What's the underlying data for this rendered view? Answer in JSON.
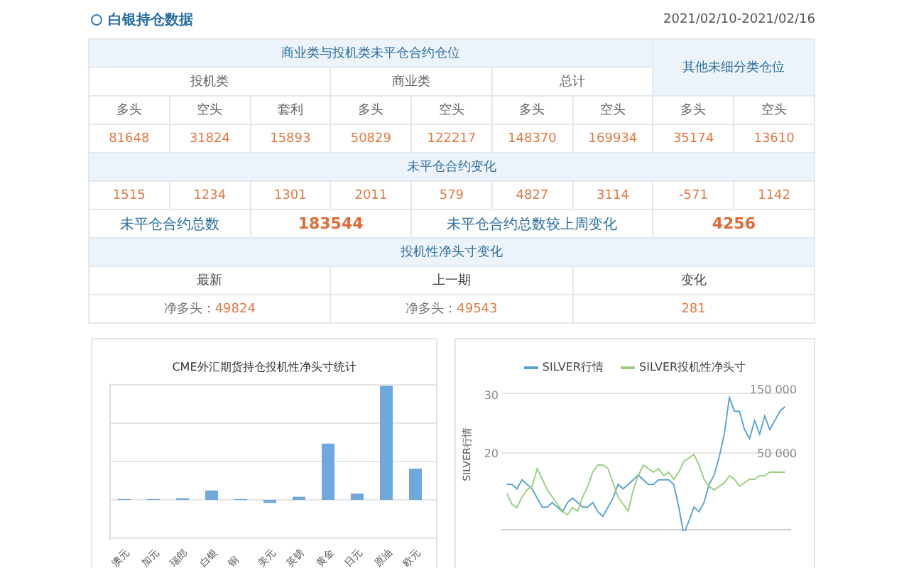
{
  "section": {
    "title": "白银持仓数据",
    "date_range": "2021/02/10-2021/02/16"
  },
  "table": {
    "group_header": "商业类与投机类未平仓合约仓位",
    "other_header": "其他未细分类仓位",
    "subgroups": [
      "投机类",
      "商业类",
      "总计"
    ],
    "columns": [
      "多头",
      "空头",
      "套利",
      "多头",
      "空头",
      "多头",
      "空头",
      "多头",
      "空头"
    ],
    "positions": [
      "81648",
      "31824",
      "15893",
      "50829",
      "122217",
      "148370",
      "169934",
      "35174",
      "13610"
    ],
    "change_title": "未平仓合约变化",
    "changes": [
      "1515",
      "1234",
      "1301",
      "2011",
      "579",
      "4827",
      "3114",
      "-571",
      "1142"
    ],
    "totals": [
      {
        "label": "未平仓合约总数",
        "value": "183544"
      },
      {
        "label": "未平仓合约总数较上周变化",
        "value": "4256"
      }
    ],
    "net_title": "投机性净头寸变化",
    "net_columns": [
      "最新",
      "上一期",
      "变化"
    ],
    "net_values": [
      {
        "label": "净多头：",
        "value": "49824"
      },
      {
        "label": "净多头：",
        "value": "49543"
      },
      {
        "value": "281"
      }
    ]
  },
  "bar_chart": {
    "title": "CME外汇期货持仓投机性净头寸统计",
    "x_labels": [
      "澳元",
      "加元",
      "瑞郎",
      "白银",
      "铜",
      "美元",
      "英镑",
      "黄金",
      "日元",
      "原油",
      "欧元"
    ]
  },
  "line_chart": {
    "legend": [
      {
        "name": "SILVER行情",
        "color": "#5aa5d0"
      },
      {
        "name": "SILVER投机性净头寸",
        "color": "#9bcf7f"
      }
    ],
    "ylabel": "SILVER行情",
    "left_ticks": [
      "30",
      "20"
    ],
    "right_ticks": [
      "150 000",
      "50 000"
    ]
  }
}
